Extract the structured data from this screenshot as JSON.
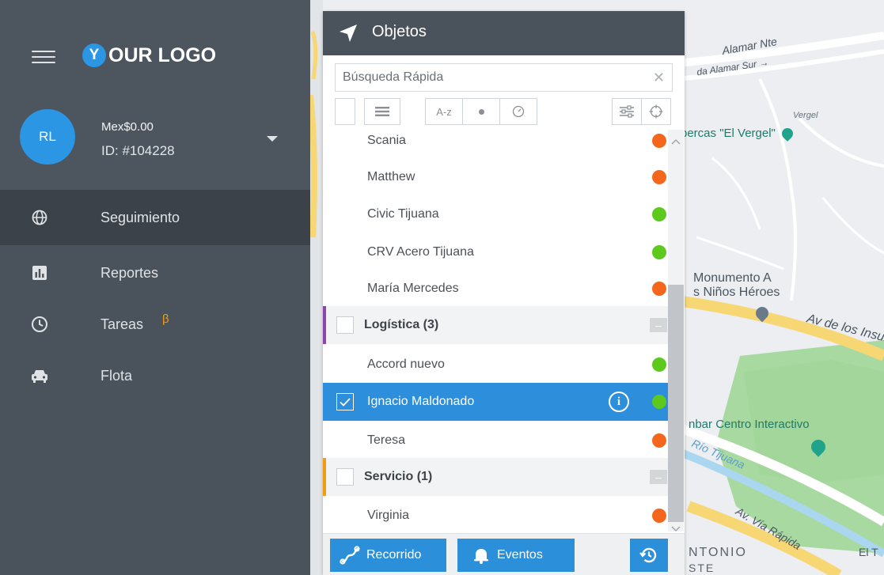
{
  "app": {
    "logo_mark": "Y",
    "logo_text": "OUR LOGO"
  },
  "account": {
    "initials": "RL",
    "balance": "Mex$0.00",
    "id": "ID: #104228"
  },
  "nav": {
    "items": [
      {
        "label": "Seguimiento",
        "icon": "globe-icon",
        "active": true
      },
      {
        "label": "Reportes",
        "icon": "bar-chart-icon",
        "active": false
      },
      {
        "label": "Tareas",
        "icon": "clock-icon",
        "active": false,
        "badge": "β"
      },
      {
        "label": "Flota",
        "icon": "car-icon",
        "active": false
      }
    ]
  },
  "panel": {
    "title": "Objetos",
    "search_placeholder": "Búsqueda Rápida",
    "toolbar": {
      "sort_label": "A-z"
    },
    "rows": [
      {
        "type": "item",
        "label": "Scania",
        "status": "orange"
      },
      {
        "type": "item",
        "label": "Matthew",
        "status": "orange"
      },
      {
        "type": "item",
        "label": "Civic Tijuana",
        "status": "green"
      },
      {
        "type": "item",
        "label": "CRV Acero Tijuana",
        "status": "green"
      },
      {
        "type": "item",
        "label": "María Mercedes",
        "status": "orange"
      },
      {
        "type": "group",
        "label": "Logística (3)",
        "color": "#8e44ad"
      },
      {
        "type": "item",
        "label": "Accord nuevo",
        "status": "green"
      },
      {
        "type": "selected",
        "label": "Ignacio Maldonado",
        "status": "green"
      },
      {
        "type": "item",
        "label": "Teresa",
        "status": "orange"
      },
      {
        "type": "group",
        "label": "Servicio (1)",
        "color": "#f39c12"
      },
      {
        "type": "item",
        "label": "Virginia",
        "status": "orange"
      }
    ],
    "footer": {
      "route_label": "Recorrido",
      "events_label": "Eventos"
    }
  },
  "map": {
    "labels": {
      "alamar_nte": "Alamar Nte",
      "alamar_sur": "da Alamar Sur →",
      "vergel": "Vergel",
      "poi_vergel": "percas \"El Vergel\"",
      "monumento": "Monumento A",
      "ninos": "s Niños Héroes",
      "av_insurgentes": "Av de los Insurg",
      "centro_interactivo": "nbar Centro Interactivo",
      "rio_tijuana": "Río Tijuana",
      "via_rapida": "Av. Vía Rápida",
      "antonio": "NTONIO",
      "este": "STE",
      "el_t": "El T"
    }
  },
  "colors": {
    "status_orange": "#f5661d",
    "status_green": "#5cc91c",
    "accent_blue": "#2b8fd9",
    "sidebar_bg": "#4a525b"
  }
}
